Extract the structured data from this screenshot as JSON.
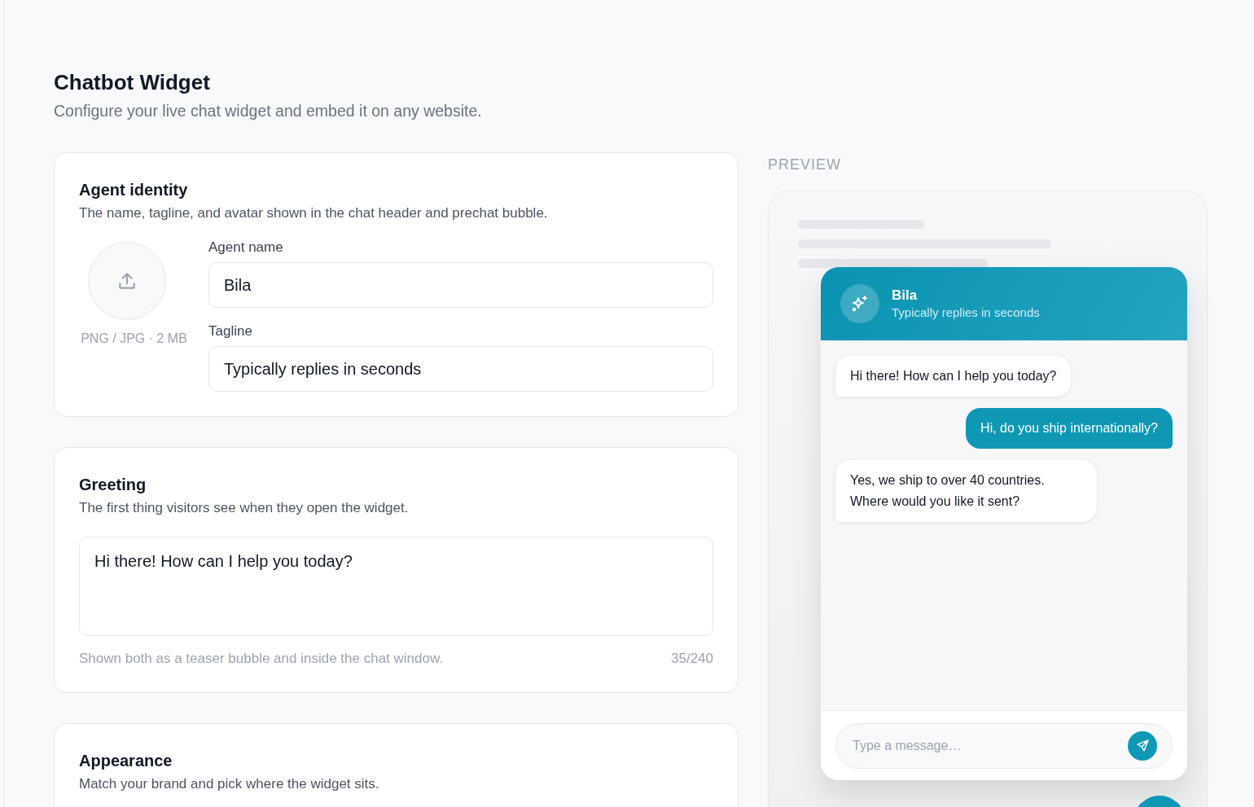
{
  "page": {
    "title": "Chatbot Widget",
    "subtitle": "Configure your live chat widget and embed it on any website."
  },
  "sections": [
    {
      "kind": "identity",
      "title": "Agent identity",
      "description": "The name, tagline, and avatar shown in the chat header and prechat bubble.",
      "avatar_hint": "PNG / JPG · 2 MB",
      "fields": [
        {
          "label": "Agent name",
          "value": "Bila"
        },
        {
          "label": "Tagline",
          "value": "Typically replies in seconds"
        }
      ]
    },
    {
      "kind": "greeting",
      "title": "Greeting",
      "description": "The first thing visitors see when they open the widget.",
      "message": "Hi there! How can I help you today?",
      "hint": "Shown both as a teaser bubble and inside the chat window.",
      "counter": "35/240"
    },
    {
      "kind": "appearance",
      "title": "Appearance",
      "description": "Match your brand and pick where the widget sits."
    }
  ],
  "preview": {
    "label": "PREVIEW",
    "agent": {
      "name": "Bila",
      "tagline": "Typically replies in seconds"
    },
    "messages": [
      {
        "kind": "bot",
        "lines": [
          "Hi there! How can I help you today?"
        ]
      },
      {
        "kind": "user",
        "lines": [
          "Hi, do you ship internationally?"
        ]
      },
      {
        "kind": "bot",
        "lines": [
          "Yes, we ship to over 40 countries.",
          "Where would you like it sent?"
        ]
      }
    ],
    "composer": {
      "placeholder": "Type a message…"
    }
  }
}
